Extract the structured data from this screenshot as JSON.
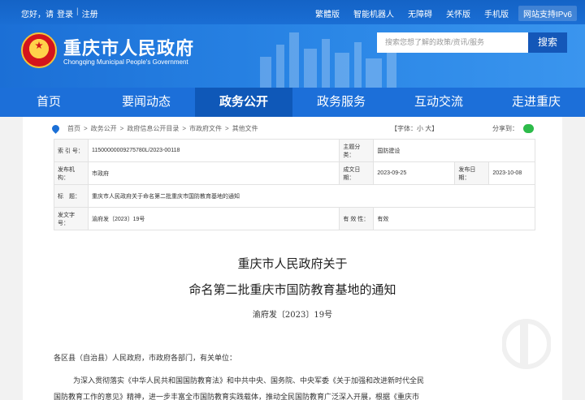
{
  "topbar": {
    "greeting": "您好，请",
    "login": "登录",
    "separator": "|",
    "register": "注册",
    "links": [
      "繁體版",
      "智能机器人",
      "无障碍",
      "关怀版",
      "手机版",
      "网站支持IPv6"
    ]
  },
  "header": {
    "title": "重庆市人民政府",
    "subtitle": "Chongqing Municipal People's Government",
    "search_placeholder": "搜索您想了解的政策/资讯/服务",
    "search_button": "搜索"
  },
  "nav": {
    "items": [
      "首页",
      "要闻动态",
      "政务公开",
      "政务服务",
      "互动交流",
      "走进重庆"
    ],
    "active": "政务公开"
  },
  "breadcrumb": [
    "首页",
    "政务公开",
    "政府信息公开目录",
    "市政府文件",
    "其他文件"
  ],
  "breadcrumb_sep": ">",
  "font_size": {
    "label": "【字体：",
    "small": "小",
    "large": "大",
    "close": "】"
  },
  "share_label": "分享到：",
  "meta": {
    "index_key": "索 引 号：",
    "index_val": "11500000009275780L/2023-00118",
    "topic_key": "主题分类：",
    "topic_val": "国防建设",
    "issuer_key": "发布机构：",
    "issuer_val": "市政府",
    "date_key": "成文日期：",
    "date_val": "2023-09-25",
    "pub_key": "发布日期：",
    "pub_val": "2023-10-08",
    "title_key": "标　题：",
    "title_val": "重庆市人民政府关于命名第二批重庆市国防教育基地的通知",
    "docno_key": "发文字号：",
    "docno_val": "渝府发〔2023〕19号",
    "valid_key": "有 效 性：",
    "valid_val": "有效"
  },
  "document": {
    "title_line1": "重庆市人民政府关于",
    "title_line2": "命名第二批重庆市国防教育基地的通知",
    "doc_no": "渝府发〔2023〕19号",
    "addressee": "各区县（自治县）人民政府，市政府各部门，有关单位：",
    "para1": "为深入贯彻落实《中华人民共和国国防教育法》和中共中央、国务院、中央军委《关于加强和改进新时代全民",
    "para2": "国防教育工作的意见》精神，进一步丰富全市国防教育实践载体，推动全民国防教育广泛深入开展，根据《重庆市"
  },
  "colors": {
    "primary": "#1c6fd9",
    "nav_active": "#0f58b8"
  }
}
